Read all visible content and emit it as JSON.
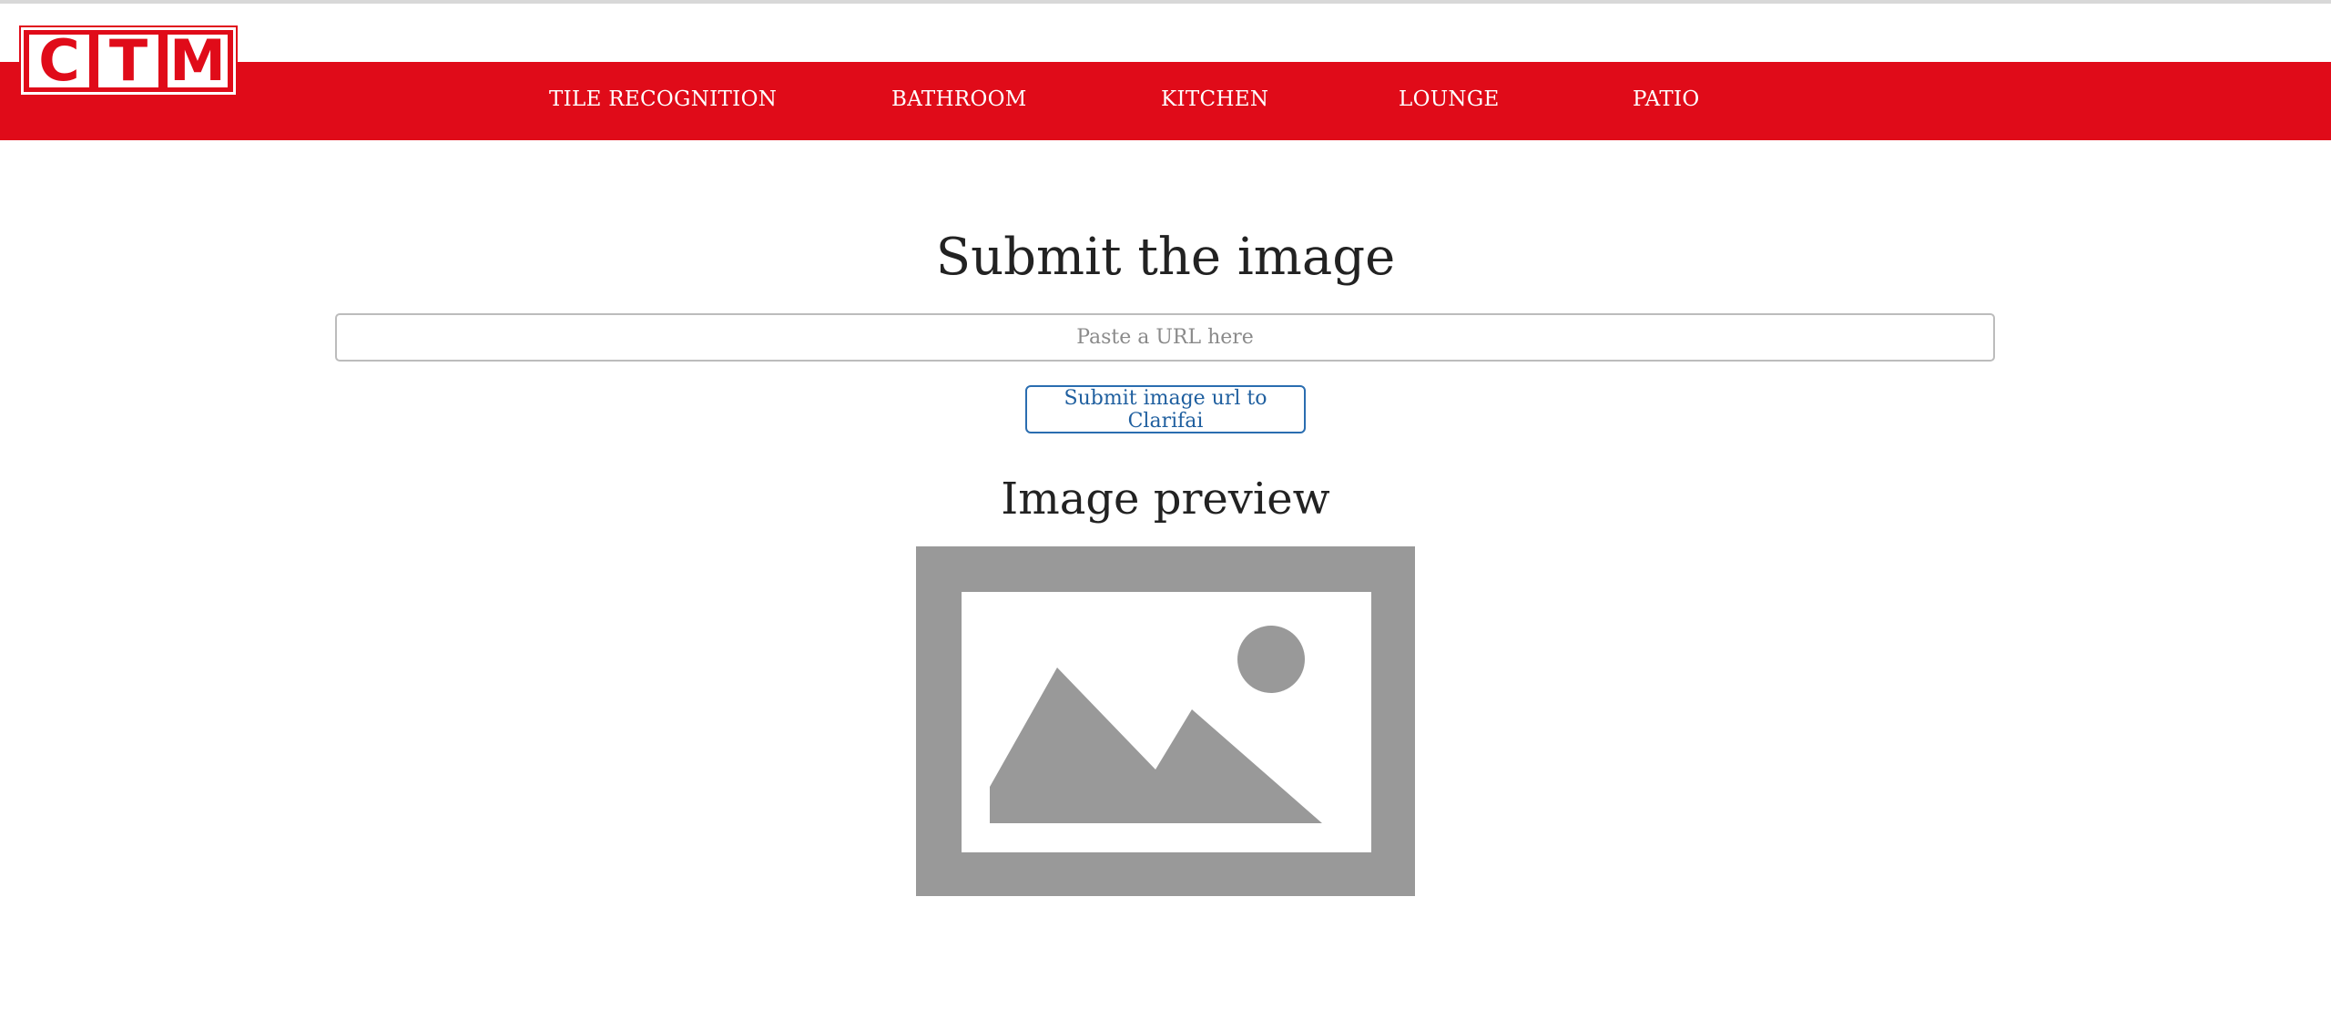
{
  "logo": {
    "letters": [
      "C",
      "T",
      "M"
    ],
    "brand_color": "#e00b19"
  },
  "nav": {
    "items": [
      {
        "label": "TILE RECOGNITION"
      },
      {
        "label": "BATHROOM"
      },
      {
        "label": "KITCHEN"
      },
      {
        "label": "LOUNGE"
      },
      {
        "label": "PATIO"
      }
    ]
  },
  "main": {
    "title": "Submit the image",
    "url_input": {
      "placeholder": "Paste a URL here",
      "value": ""
    },
    "submit_label": "Submit image url to Clarifai",
    "preview_title": "Image preview",
    "preview_icon": "image-placeholder-icon"
  },
  "colors": {
    "nav_background": "#e00b19",
    "button_border": "#2a6db0",
    "placeholder_gray": "#999999"
  }
}
